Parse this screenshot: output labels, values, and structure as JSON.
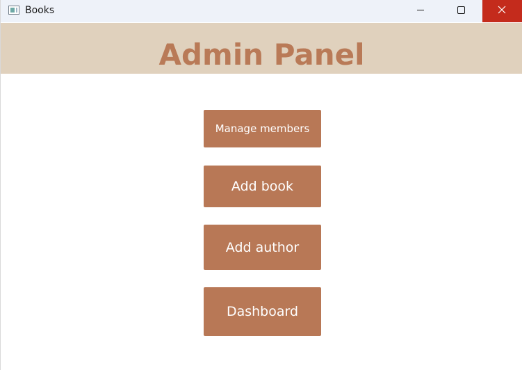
{
  "window": {
    "title": "Books",
    "controls": {
      "minimize_icon": "minimize-icon",
      "maximize_icon": "maximize-icon",
      "close_icon": "close-icon"
    }
  },
  "header": {
    "title": "Admin Panel"
  },
  "menu": {
    "manage_members": "Manage members",
    "add_book": "Add book",
    "add_author": "Add author",
    "dashboard": "Dashboard"
  },
  "colors": {
    "title_bar": "#eef2f9",
    "header_band": "#e0d1bd",
    "title_text": "#b97a57",
    "button": "#b87856",
    "close_button": "#c42b1c"
  }
}
